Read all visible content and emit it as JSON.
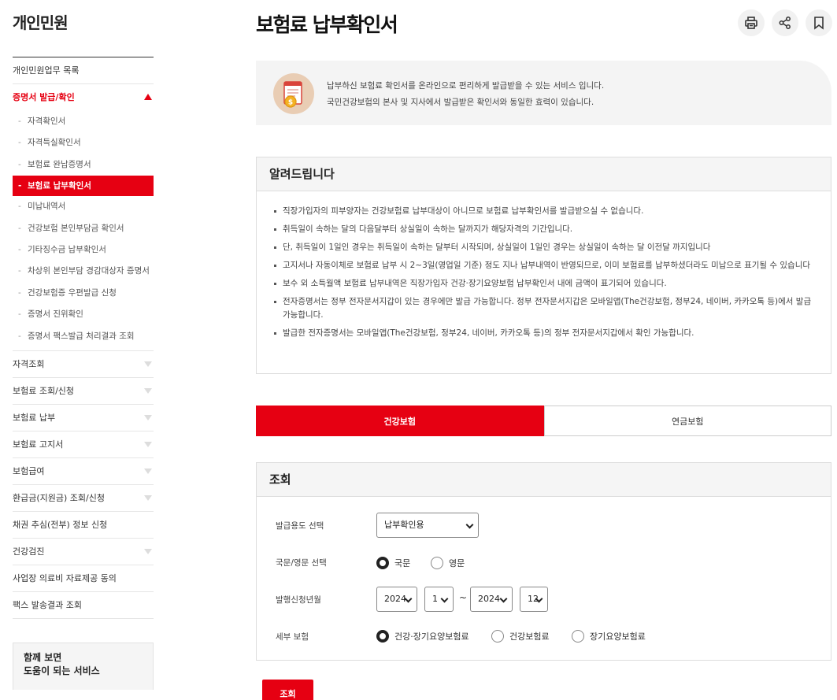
{
  "sidebar": {
    "title": "개인민원",
    "menu_top": "개인민원업무 목록",
    "active_section": "증명서 발급/확인",
    "sub_items": [
      "자격확인서",
      "자격득실확인서",
      "보험료 완납증명서",
      "보험료 납부확인서",
      "미납내역서",
      "건강보험 본인부담금 확인서",
      "기타징수금 납부확인서",
      "차상위 본인부담 경감대상자 증명서",
      "건강보험증 우편발급 신청",
      "증명서 진위확인",
      "증명서 팩스발급 처리결과 조회"
    ],
    "sections": [
      "자격조회",
      "보험료 조회/신청",
      "보험료 납부",
      "보험료 고지서",
      "보험급여",
      "환급금(지원금) 조회/신청",
      "채권 추심(전부) 정보 신청",
      "건강검진",
      "사업장 의료비 자료제공 동의",
      "팩스 발송결과 조회"
    ],
    "box_line1": "함께 보면",
    "box_line2": "도움이 되는 서비스"
  },
  "page": {
    "title": "보험료 납부확인서",
    "intro_line1": "납부하신 보험료 확인서를 온라인으로 편리하게 발급받을 수 있는 서비스 입니다.",
    "intro_line2": "국민건강보험의 본사 및 지사에서 발급받은 확인서와 동일한 효력이 있습니다."
  },
  "notice": {
    "heading": "알려드립니다",
    "items": [
      "직장가입자의 피부양자는 건강보험료 납부대상이 아니므로 보험료 납부확인서를 발급받으실 수 없습니다.",
      "취득일이 속하는 달의 다음달부터 상실일이 속하는 달까지가 해당자격의 기간입니다.",
      "단, 취득일이 1일인 경우는 취득일이 속하는 달부터 시작되며, 상실일이 1일인 경우는 상실일이 속하는 달 이전달 까지입니다",
      "고지서나 자동이체로 보험료 납부 시 2~3일(영업일 기준) 정도 지나 납부내역이 반영되므로, 이미 보험료를 납부하셨더라도 미납으로 표기될 수 있습니다",
      "보수 외 소득월액 보험료 납부내역은 직장가입자 건강·장기요양보험 납부확인서 내에 금액이 표기되어 있습니다.",
      "전자증명서는 정부 전자문서지갑이 있는 경우에만 발급 가능합니다. 정부 전자문서지갑은 모바일앱(The건강보험, 정부24, 네이버, 카카오톡 등)에서 발급 가능합니다.",
      "발급한 전자증명서는 모바일앱(The건강보험, 정부24, 네이버, 카카오톡 등)의 정부 전자문서지갑에서 확인 가능합니다."
    ]
  },
  "tabs": [
    "건강보험",
    "연금보험"
  ],
  "query": {
    "heading": "조회",
    "purpose_label": "발급용도 선택",
    "purpose_value": "납부확인용",
    "lang_label": "국문/영문 선택",
    "lang_options": [
      "국문",
      "영문"
    ],
    "period_label": "발행신청년월",
    "from_year": "2024",
    "from_month": "1",
    "to_year": "2024",
    "to_month": "12",
    "tilde": "~",
    "insurance_label": "세부 보험",
    "insurance_options": [
      "건강·장기요양보험료",
      "건강보험료",
      "장기요양보험료"
    ],
    "submit": "조회"
  },
  "colors": {
    "brand": "#e60012"
  }
}
